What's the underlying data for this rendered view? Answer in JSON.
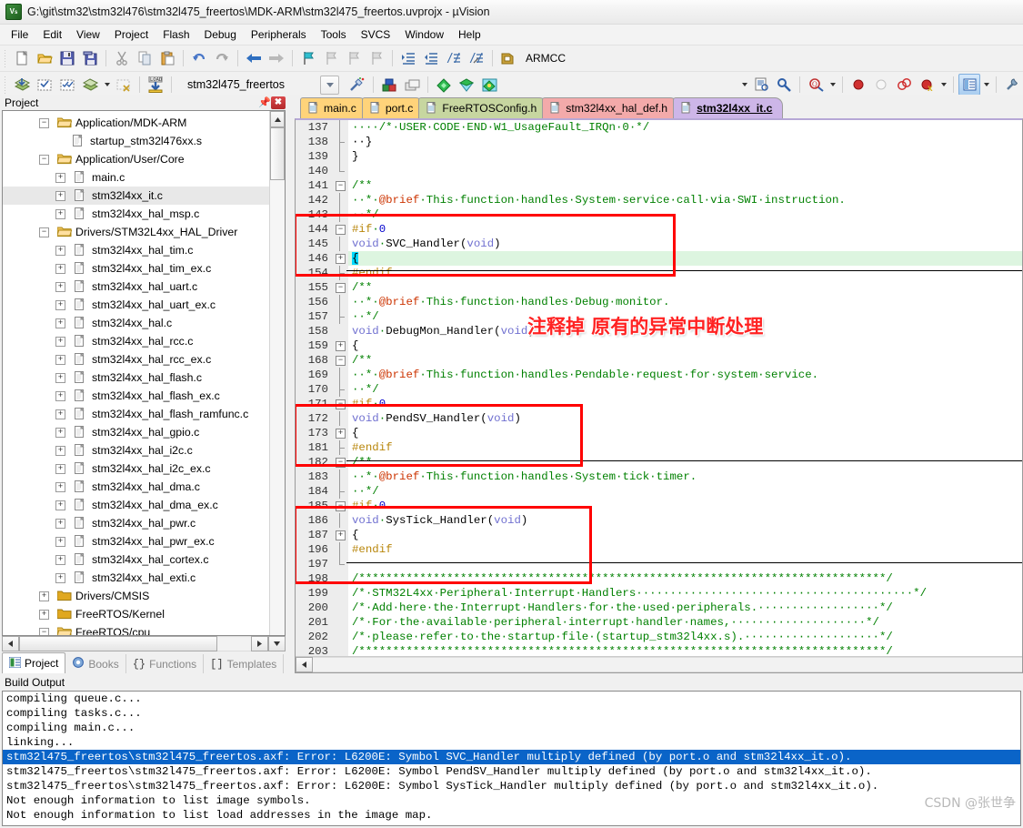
{
  "window": {
    "title": "G:\\git\\stm32\\stm32l476\\stm32l475_freertos\\MDK-ARM\\stm32l475_freertos.uvprojx - µVision",
    "icon": "uvision-logo-icon"
  },
  "menubar": {
    "items": [
      "File",
      "Edit",
      "View",
      "Project",
      "Flash",
      "Debug",
      "Peripherals",
      "Tools",
      "SVCS",
      "Window",
      "Help"
    ]
  },
  "toolbar1": {
    "buttons": [
      "new-file-icon",
      "open-file-icon",
      "save-icon",
      "save-all-icon",
      "cut-icon",
      "copy-icon",
      "paste-icon",
      "undo-icon",
      "redo-icon",
      "navigate-back-icon",
      "navigate-forward-icon",
      "bookmark-toggle-icon",
      "bookmark-prev-icon",
      "bookmark-next-icon",
      "bookmark-clear-icon",
      "indent-icon",
      "outdent-icon",
      "comment-icon",
      "uncomment-icon",
      "target-options-icon"
    ],
    "compiler_label": "ARMCC"
  },
  "toolbar2": {
    "buttons": [
      "build-icon",
      "rebuild-icon",
      "batch-build-icon",
      "build-target-icon",
      "stop-build-icon",
      "download-icon"
    ],
    "project_value": "stm32l475_freertos",
    "right_buttons": [
      "target-options-wizard-icon",
      "manage-components-icon",
      "manage-project-items-icon",
      "configure-pack-icon",
      "pack-installer-icon",
      "pack-manager-icon"
    ],
    "debug_buttons": [
      "source-browser-icon",
      "find-in-files-icon",
      "zoom-icon",
      "insert-breakpoint-icon",
      "disable-breakpoint-icon",
      "kill-all-breakpoints-icon",
      "disable-all-breakpoints-icon",
      "window-layout-icon",
      "configuration-wizard-icon"
    ]
  },
  "project_panel": {
    "title": "Project",
    "pin_icon": "pin-icon",
    "close_icon": "close-icon",
    "tabs": [
      {
        "label": "Project",
        "icon": "project-tab-icon",
        "selected": true
      },
      {
        "label": "Books",
        "icon": "books-tab-icon",
        "selected": false
      },
      {
        "label": "Functions",
        "icon": "functions-tab-icon",
        "selected": false
      },
      {
        "label": "Templates",
        "icon": "templates-tab-icon",
        "selected": false
      }
    ],
    "tree": [
      {
        "label": "Application/MDK-ARM",
        "type": "folder",
        "depth": 1,
        "expander": "minus",
        "selected": false
      },
      {
        "label": "startup_stm32l476xx.s",
        "type": "file",
        "depth": 2,
        "expander": "none",
        "selected": false
      },
      {
        "label": "Application/User/Core",
        "type": "folder",
        "depth": 1,
        "expander": "minus",
        "selected": false
      },
      {
        "label": "main.c",
        "type": "file",
        "depth": 2,
        "expander": "plus",
        "selected": false
      },
      {
        "label": "stm32l4xx_it.c",
        "type": "file",
        "depth": 2,
        "expander": "plus",
        "selected": true
      },
      {
        "label": "stm32l4xx_hal_msp.c",
        "type": "file",
        "depth": 2,
        "expander": "plus",
        "selected": false
      },
      {
        "label": "Drivers/STM32L4xx_HAL_Driver",
        "type": "folder",
        "depth": 1,
        "expander": "minus",
        "selected": false
      },
      {
        "label": "stm32l4xx_hal_tim.c",
        "type": "file",
        "depth": 2,
        "expander": "plus",
        "selected": false
      },
      {
        "label": "stm32l4xx_hal_tim_ex.c",
        "type": "file",
        "depth": 2,
        "expander": "plus",
        "selected": false
      },
      {
        "label": "stm32l4xx_hal_uart.c",
        "type": "file",
        "depth": 2,
        "expander": "plus",
        "selected": false
      },
      {
        "label": "stm32l4xx_hal_uart_ex.c",
        "type": "file",
        "depth": 2,
        "expander": "plus",
        "selected": false
      },
      {
        "label": "stm32l4xx_hal.c",
        "type": "file",
        "depth": 2,
        "expander": "plus",
        "selected": false
      },
      {
        "label": "stm32l4xx_hal_rcc.c",
        "type": "file",
        "depth": 2,
        "expander": "plus",
        "selected": false
      },
      {
        "label": "stm32l4xx_hal_rcc_ex.c",
        "type": "file",
        "depth": 2,
        "expander": "plus",
        "selected": false
      },
      {
        "label": "stm32l4xx_hal_flash.c",
        "type": "file",
        "depth": 2,
        "expander": "plus",
        "selected": false
      },
      {
        "label": "stm32l4xx_hal_flash_ex.c",
        "type": "file",
        "depth": 2,
        "expander": "plus",
        "selected": false
      },
      {
        "label": "stm32l4xx_hal_flash_ramfunc.c",
        "type": "file",
        "depth": 2,
        "expander": "plus",
        "selected": false
      },
      {
        "label": "stm32l4xx_hal_gpio.c",
        "type": "file",
        "depth": 2,
        "expander": "plus",
        "selected": false
      },
      {
        "label": "stm32l4xx_hal_i2c.c",
        "type": "file",
        "depth": 2,
        "expander": "plus",
        "selected": false
      },
      {
        "label": "stm32l4xx_hal_i2c_ex.c",
        "type": "file",
        "depth": 2,
        "expander": "plus",
        "selected": false
      },
      {
        "label": "stm32l4xx_hal_dma.c",
        "type": "file",
        "depth": 2,
        "expander": "plus",
        "selected": false
      },
      {
        "label": "stm32l4xx_hal_dma_ex.c",
        "type": "file",
        "depth": 2,
        "expander": "plus",
        "selected": false
      },
      {
        "label": "stm32l4xx_hal_pwr.c",
        "type": "file",
        "depth": 2,
        "expander": "plus",
        "selected": false
      },
      {
        "label": "stm32l4xx_hal_pwr_ex.c",
        "type": "file",
        "depth": 2,
        "expander": "plus",
        "selected": false
      },
      {
        "label": "stm32l4xx_hal_cortex.c",
        "type": "file",
        "depth": 2,
        "expander": "plus",
        "selected": false
      },
      {
        "label": "stm32l4xx_hal_exti.c",
        "type": "file",
        "depth": 2,
        "expander": "plus",
        "selected": false
      },
      {
        "label": "Drivers/CMSIS",
        "type": "folder-closed",
        "depth": 1,
        "expander": "plus",
        "selected": false
      },
      {
        "label": "FreeRTOS/Kernel",
        "type": "folder-closed",
        "depth": 1,
        "expander": "plus",
        "selected": false
      },
      {
        "label": "FreeRTOS/cpu",
        "type": "folder",
        "depth": 1,
        "expander": "minus",
        "selected": false
      }
    ]
  },
  "editor": {
    "tabs": [
      {
        "label": "main.c",
        "selected": false
      },
      {
        "label": "port.c",
        "selected": false
      },
      {
        "label": "FreeRTOSConfig.h",
        "selected": false
      },
      {
        "label": "stm32l4xx_hal_def.h",
        "selected": false
      },
      {
        "label": "stm32l4xx_it.c",
        "selected": true
      }
    ],
    "annotation": "注释掉 原有的异常中断处理",
    "lines": [
      {
        "n": "137",
        "fold": "line",
        "html": "<span class=\"c-com\">····/*·USER·CODE·END·W1_UsageFault_IRQn·0·*/</span>"
      },
      {
        "n": "138",
        "fold": "end",
        "html": "<span class=\"c-pun\">··}</span>"
      },
      {
        "n": "139",
        "fold": "line2",
        "html": "<span class=\"c-pun\">}</span>"
      },
      {
        "n": "140",
        "fold": "endbot",
        "html": ""
      },
      {
        "n": "141",
        "fold": "minus",
        "html": "<span class=\"c-com\">/**</span>"
      },
      {
        "n": "142",
        "fold": "line",
        "html": "<span class=\"c-com\">··*·</span><span class=\"c-at\">@brief</span><span class=\"c-com\">·This·function·handles·System·service·call·via·SWI·instruction.</span>"
      },
      {
        "n": "143",
        "fold": "end",
        "html": "<span class=\"c-com\">··*/</span>"
      },
      {
        "n": "144",
        "fold": "minus",
        "html": "<span class=\"c-pp\">#if</span><span class=\"c-com\">·</span><span class=\"c-num\">0</span>"
      },
      {
        "n": "145",
        "fold": "line",
        "html": "<span class=\"c-kw\">void</span><span class=\"c-com\">·</span><span class=\"c-pun\">SVC_Handler(</span><span class=\"c-kw\">void</span><span class=\"c-pun\">)</span>"
      },
      {
        "n": "146",
        "fold": "plus",
        "hl": true,
        "html": "<span class=\"c-sel\">{</span>"
      },
      {
        "n": "154",
        "fold": "end",
        "html": "<span class=\"c-pp\">#endif</span>"
      },
      {
        "n": "155",
        "fold": "minus",
        "html": "<span class=\"c-com\">/**</span>"
      },
      {
        "n": "156",
        "fold": "line",
        "html": "<span class=\"c-com\">··*·</span><span class=\"c-at\">@brief</span><span class=\"c-com\">·This·function·handles·Debug·monitor.</span>"
      },
      {
        "n": "157",
        "fold": "end",
        "html": "<span class=\"c-com\">··*/</span>"
      },
      {
        "n": "158",
        "fold": "none",
        "html": "<span class=\"c-kw\">void</span><span class=\"c-com\">·</span><span class=\"c-pun\">DebugMon_Handler(</span><span class=\"c-kw\">void</span><span class=\"c-pun\">)</span>"
      },
      {
        "n": "159",
        "fold": "plus",
        "html": "<span class=\"c-pun\">{</span>"
      },
      {
        "n": "168",
        "fold": "minus",
        "html": "<span class=\"c-com\">/**</span>"
      },
      {
        "n": "169",
        "fold": "line",
        "html": "<span class=\"c-com\">··*·</span><span class=\"c-at\">@brief</span><span class=\"c-com\">·This·function·handles·Pendable·request·for·system·service.</span>"
      },
      {
        "n": "170",
        "fold": "end",
        "html": "<span class=\"c-com\">··*/</span>"
      },
      {
        "n": "171",
        "fold": "minus",
        "html": "<span class=\"c-pp\">#if</span><span class=\"c-com\">·</span><span class=\"c-num\">0</span>"
      },
      {
        "n": "172",
        "fold": "line",
        "html": "<span class=\"c-kw\">void</span><span class=\"c-com\">·</span><span class=\"c-pun\">PendSV_Handler(</span><span class=\"c-kw\">void</span><span class=\"c-pun\">)</span>"
      },
      {
        "n": "173",
        "fold": "plus",
        "html": "<span class=\"c-pun\">{</span>"
      },
      {
        "n": "181",
        "fold": "end",
        "html": "<span class=\"c-pp\">#endif</span>"
      },
      {
        "n": "182",
        "fold": "minus",
        "html": "<span class=\"c-com\">/**</span>"
      },
      {
        "n": "183",
        "fold": "line",
        "html": "<span class=\"c-com\">··*·</span><span class=\"c-at\">@brief</span><span class=\"c-com\">·This·function·handles·System·tick·timer.</span>"
      },
      {
        "n": "184",
        "fold": "end",
        "html": "<span class=\"c-com\">··*/</span>"
      },
      {
        "n": "185",
        "fold": "minus",
        "html": "<span class=\"c-pp\">#if</span><span class=\"c-com\">·</span><span class=\"c-num\">0</span>"
      },
      {
        "n": "186",
        "fold": "line",
        "html": "<span class=\"c-kw\">void</span><span class=\"c-com\">·</span><span class=\"c-pun\">SysTick_Handler(</span><span class=\"c-kw\">void</span><span class=\"c-pun\">)</span>"
      },
      {
        "n": "187",
        "fold": "plus",
        "html": "<span class=\"c-pun\">{</span>"
      },
      {
        "n": "196",
        "fold": "line",
        "html": "<span class=\"c-pp\">#endif</span>"
      },
      {
        "n": "197",
        "fold": "endbot",
        "html": ""
      },
      {
        "n": "198",
        "fold": "none",
        "html": "<span class=\"c-com\">/******************************************************************************/</span>"
      },
      {
        "n": "199",
        "fold": "none",
        "html": "<span class=\"c-com\">/*·STM32L4xx·Peripheral·Interrupt·Handlers·········································*/</span>"
      },
      {
        "n": "200",
        "fold": "none",
        "html": "<span class=\"c-com\">/*·Add·here·the·Interrupt·Handlers·for·the·used·peripherals.··················*/</span>"
      },
      {
        "n": "201",
        "fold": "none",
        "html": "<span class=\"c-com\">/*·For·the·available·peripheral·interrupt·handler·names,····················*/</span>"
      },
      {
        "n": "202",
        "fold": "none",
        "html": "<span class=\"c-com\">/*·please·refer·to·the·startup·file·(startup_stm32l4xx.s).····················*/</span>"
      },
      {
        "n": "203",
        "fold": "none",
        "html": "<span class=\"c-com\">/******************************************************************************/</span>"
      }
    ]
  },
  "build_output": {
    "title": "Build Output",
    "lines": [
      {
        "text": "compiling queue.c...",
        "selected": false
      },
      {
        "text": "compiling tasks.c...",
        "selected": false
      },
      {
        "text": "compiling main.c...",
        "selected": false
      },
      {
        "text": "linking...",
        "selected": false
      },
      {
        "text": "stm32l475_freertos\\stm32l475_freertos.axf: Error: L6200E: Symbol SVC_Handler multiply defined (by port.o and stm32l4xx_it.o).",
        "selected": true
      },
      {
        "text": "stm32l475_freertos\\stm32l475_freertos.axf: Error: L6200E: Symbol PendSV_Handler multiply defined (by port.o and stm32l4xx_it.o).",
        "selected": false
      },
      {
        "text": "stm32l475_freertos\\stm32l475_freertos.axf: Error: L6200E: Symbol SysTick_Handler multiply defined (by port.o and stm32l4xx_it.o).",
        "selected": false
      },
      {
        "text": "Not enough information to list image symbols.",
        "selected": false
      },
      {
        "text": "Not enough information to list load addresses in the image map.",
        "selected": false
      }
    ],
    "watermark": "CSDN @张世争"
  },
  "colors": {
    "accent_purple": "#cdb6e8",
    "tab_orange": "#ffd37a",
    "tab_green": "#c7d6a0",
    "tab_red": "#f3aaaa",
    "annotation_red": "#ff0000",
    "selection_blue": "#0a64c8",
    "hl_green": "#ddf5e0"
  }
}
